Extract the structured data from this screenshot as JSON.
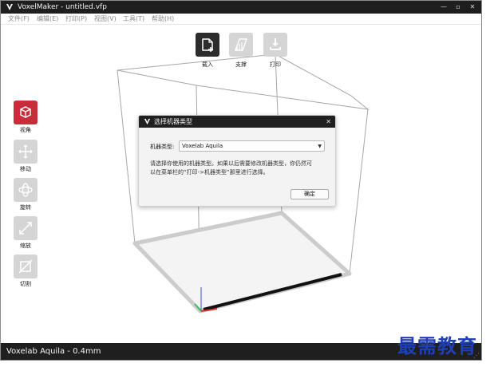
{
  "window": {
    "title": "VoxelMaker - untitled.vfp",
    "minimize_glyph": "—",
    "maximize_glyph": "▫",
    "close_glyph": "✕"
  },
  "menu": [
    {
      "label": "文件(F)"
    },
    {
      "label": "编辑(E)"
    },
    {
      "label": "打印(P)"
    },
    {
      "label": "视图(V)"
    },
    {
      "label": "工具(T)"
    },
    {
      "label": "帮助(H)"
    }
  ],
  "top_toolbar": [
    {
      "label": "载入",
      "icon": "load-file-icon"
    },
    {
      "label": "支撑",
      "icon": "support-icon"
    },
    {
      "label": "打印",
      "icon": "print-icon"
    }
  ],
  "side_toolbar": [
    {
      "label": "视角",
      "icon": "view-cube-icon"
    },
    {
      "label": "移动",
      "icon": "move-arrows-icon"
    },
    {
      "label": "旋转",
      "icon": "rotate-icon"
    },
    {
      "label": "缩放",
      "icon": "scale-icon"
    },
    {
      "label": "切割",
      "icon": "cut-icon"
    }
  ],
  "dialog": {
    "title": "选择机器类型",
    "close_glyph": "✕",
    "field_label": "机器类型:",
    "selected_machine": "Voxelab Aquila",
    "message_line1": "请选择你使用的机器类型。如果以后需要修改机器类型，你仍然可",
    "message_line2": "以在菜单栏的“打印->机器类型”那里进行选择。",
    "ok_label": "确定"
  },
  "status": {
    "text": "Voxelab Aquila - 0.4mm"
  },
  "watermark": {
    "text": "最需教育"
  },
  "colors": {
    "accent_red": "#c92d39",
    "titlebar_bg": "#1e1e1e",
    "statusbar_bg": "#1f1f1f",
    "bed_border": "#cccccc",
    "bed_front_edge": "#111111",
    "watermark_blue": "#1f3fb5"
  }
}
